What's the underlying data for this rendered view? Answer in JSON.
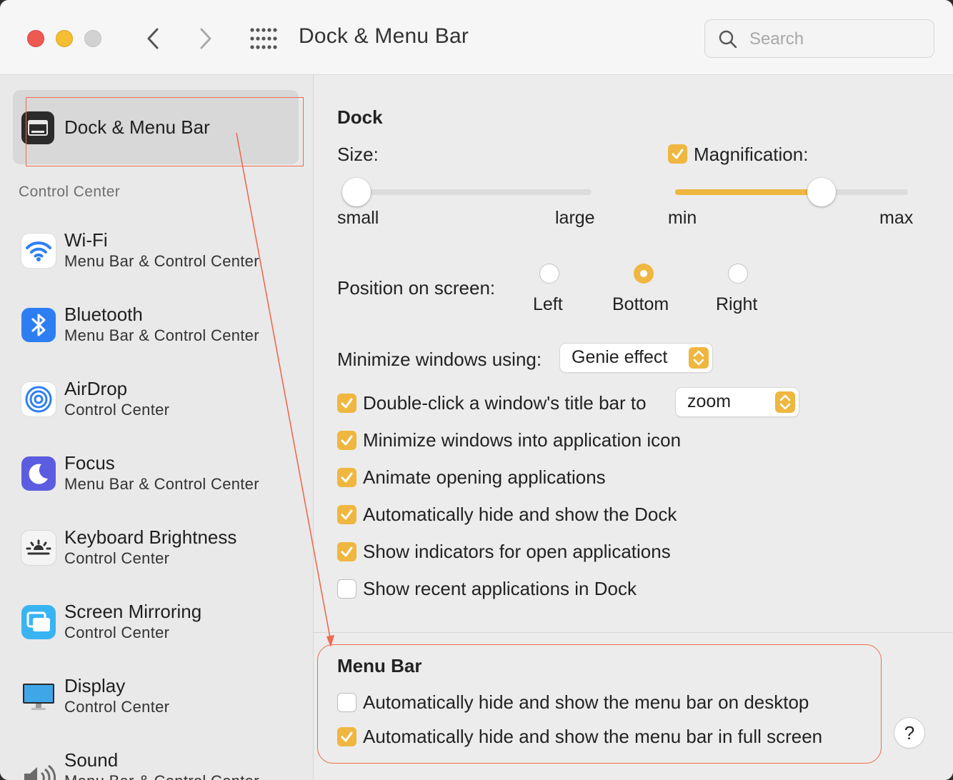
{
  "window": {
    "title": "Dock & Menu Bar",
    "search_placeholder": "Search"
  },
  "sidebar": {
    "selected": {
      "label": "Dock & Menu Bar",
      "icon": "dock-icon"
    },
    "section_label": "Control Center",
    "items": [
      {
        "title": "Wi-Fi",
        "subtitle": "Menu Bar & Control Center",
        "icon": "wifi-icon"
      },
      {
        "title": "Bluetooth",
        "subtitle": "Menu Bar & Control Center",
        "icon": "bluetooth-icon"
      },
      {
        "title": "AirDrop",
        "subtitle": "Control Center",
        "icon": "airdrop-icon"
      },
      {
        "title": "Focus",
        "subtitle": "Menu Bar & Control Center",
        "icon": "moon-icon"
      },
      {
        "title": "Keyboard Brightness",
        "subtitle": "Control Center",
        "icon": "keyboard-brightness-icon"
      },
      {
        "title": "Screen Mirroring",
        "subtitle": "Control Center",
        "icon": "screen-mirroring-icon"
      },
      {
        "title": "Display",
        "subtitle": "Control Center",
        "icon": "display-icon"
      },
      {
        "title": "Sound",
        "subtitle": "Menu Bar & Control Center",
        "icon": "speaker-icon"
      }
    ]
  },
  "dock": {
    "heading": "Dock",
    "size_label": "Size:",
    "size_min_label": "small",
    "size_max_label": "large",
    "size_value": 0.05,
    "magnification_label": "Magnification:",
    "magnification_checked": true,
    "mag_min_label": "min",
    "mag_max_label": "max",
    "magnification_value": 0.63,
    "position_label": "Position on screen:",
    "position_options": [
      "Left",
      "Bottom",
      "Right"
    ],
    "position_selected": "Bottom",
    "minimize_label": "Minimize windows using:",
    "minimize_value": "Genie effect",
    "double_click_label": "Double-click a window's title bar to",
    "double_click_value": "zoom",
    "double_click_checked": true,
    "options": [
      {
        "label": "Minimize windows into application icon",
        "checked": true
      },
      {
        "label": "Animate opening applications",
        "checked": true
      },
      {
        "label": "Automatically hide and show the Dock",
        "checked": true
      },
      {
        "label": "Show indicators for open applications",
        "checked": true
      },
      {
        "label": "Show recent applications in Dock",
        "checked": false
      }
    ]
  },
  "menu_bar": {
    "heading": "Menu Bar",
    "options": [
      {
        "label": "Automatically hide and show the menu bar on desktop",
        "checked": false
      },
      {
        "label": "Automatically hide and show the menu bar in full screen",
        "checked": true
      }
    ]
  },
  "help_label": "?",
  "colors": {
    "accent": "#efb740",
    "annotation": "#ef6a50"
  }
}
